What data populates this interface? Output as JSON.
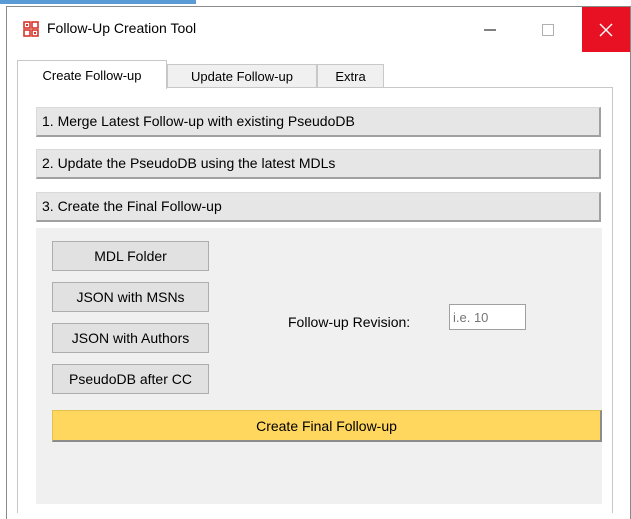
{
  "window": {
    "title": "Follow-Up Creation Tool",
    "app_icon": "app-logo-icon",
    "close_color": "#e81123"
  },
  "tabs": [
    {
      "label": "Create Follow-up",
      "active": true
    },
    {
      "label": "Update Follow-up",
      "active": false
    },
    {
      "label": "Extra",
      "active": false
    }
  ],
  "steps": [
    {
      "label": "1. Merge Latest Follow-up with existing PseudoDB"
    },
    {
      "label": "2. Update the PseudoDB using the latest MDLs"
    },
    {
      "label": "3. Create the Final Follow-up"
    }
  ],
  "files": {
    "mdl_folder": "MDL Folder",
    "json_msns": "JSON with MSNs",
    "json_authors": "JSON with Authors",
    "pseudodb_cc": "PseudoDB after CC"
  },
  "revision": {
    "label": "Follow-up Revision:",
    "value": "",
    "placeholder": "i.e. 10"
  },
  "actions": {
    "create_final": "Create Final Follow-up",
    "accent_color": "#ffd75f"
  }
}
